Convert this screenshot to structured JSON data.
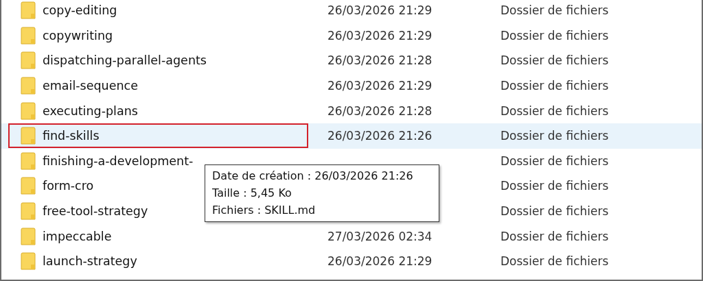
{
  "rows": [
    {
      "name": "copy-editing",
      "date": "26/03/2026 21:29",
      "type": "Dossier de fichiers",
      "selected": false,
      "highlighted": false
    },
    {
      "name": "copywriting",
      "date": "26/03/2026 21:29",
      "type": "Dossier de fichiers",
      "selected": false,
      "highlighted": false
    },
    {
      "name": "dispatching-parallel-agents",
      "date": "26/03/2026 21:28",
      "type": "Dossier de fichiers",
      "selected": false,
      "highlighted": false
    },
    {
      "name": "email-sequence",
      "date": "26/03/2026 21:29",
      "type": "Dossier de fichiers",
      "selected": false,
      "highlighted": false
    },
    {
      "name": "executing-plans",
      "date": "26/03/2026 21:28",
      "type": "Dossier de fichiers",
      "selected": false,
      "highlighted": false
    },
    {
      "name": "find-skills",
      "date": "26/03/2026 21:26",
      "type": "Dossier de fichiers",
      "selected": true,
      "highlighted": true
    },
    {
      "name": "finishing-a-development-",
      "type": "Dossier de fichiers",
      "selected": false,
      "highlighted": false
    },
    {
      "name": "form-cro",
      "type": "Dossier de fichiers",
      "selected": false,
      "highlighted": false
    },
    {
      "name": "free-tool-strategy",
      "type": "Dossier de fichiers",
      "selected": false,
      "highlighted": false
    },
    {
      "name": "impeccable",
      "date": "27/03/2026 02:34",
      "type": "Dossier de fichiers",
      "selected": false,
      "highlighted": false
    },
    {
      "name": "launch-strategy",
      "date": "26/03/2026 21:29",
      "type": "Dossier de fichiers",
      "selected": false,
      "highlighted": false
    }
  ],
  "tooltip": {
    "lines": [
      "Date de création : 26/03/2026 21:26",
      "Taille : 5,45 Ko",
      "Fichiers : SKILL.md"
    ]
  }
}
